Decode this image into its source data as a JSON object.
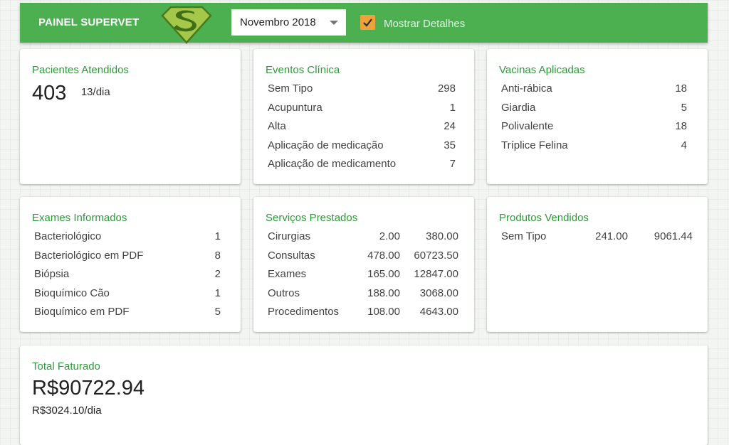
{
  "header": {
    "brand": "PAINEL SUPERVET",
    "month_selected": "Novembro 2018",
    "show_details_label": "Mostrar Detalhes",
    "show_details_checked": true
  },
  "colors": {
    "header_bg": "#4caf50",
    "accent": "#f0a23a",
    "title": "#2e9a3a"
  },
  "pacientes": {
    "title": "Pacientes Atendidos",
    "total": "403",
    "per_day": "13/dia"
  },
  "eventos": {
    "title": "Eventos Clínica",
    "rows": [
      {
        "label": "Sem Tipo",
        "value": "298"
      },
      {
        "label": "Acupuntura",
        "value": "1"
      },
      {
        "label": "Alta",
        "value": "24"
      },
      {
        "label": "Aplicação de medicação",
        "value": "35"
      },
      {
        "label": "Aplicação de medicamento",
        "value": "7"
      }
    ]
  },
  "vacinas": {
    "title": "Vacinas Aplicadas",
    "rows": [
      {
        "label": "Anti-rábica",
        "value": "18"
      },
      {
        "label": "Giardia",
        "value": "5"
      },
      {
        "label": "Polivalente",
        "value": "18"
      },
      {
        "label": "Tríplice Felina",
        "value": "4"
      }
    ]
  },
  "exames": {
    "title": "Exames Informados",
    "rows": [
      {
        "label": "Bacteriológico",
        "value": "1"
      },
      {
        "label": "Bacteriológico em PDF",
        "value": "8"
      },
      {
        "label": "Biópsia",
        "value": "2"
      },
      {
        "label": "Bioquímico Cão",
        "value": "1"
      },
      {
        "label": "Bioquímico em PDF",
        "value": "5"
      }
    ]
  },
  "servicos": {
    "title": "Serviços Prestados",
    "rows": [
      {
        "label": "Cirurgias",
        "qty": "2.00",
        "amount": "380.00"
      },
      {
        "label": "Consultas",
        "qty": "478.00",
        "amount": "60723.50"
      },
      {
        "label": "Exames",
        "qty": "165.00",
        "amount": "12847.00"
      },
      {
        "label": "Outros",
        "qty": "188.00",
        "amount": "3068.00"
      },
      {
        "label": "Procedimentos",
        "qty": "108.00",
        "amount": "4643.00"
      }
    ]
  },
  "produtos": {
    "title": "Produtos Vendidos",
    "rows": [
      {
        "label": "Sem Tipo",
        "qty": "241.00",
        "amount": "9061.44"
      }
    ]
  },
  "total": {
    "title": "Total Faturado",
    "value": "R$90722.94",
    "per_day": "R$3024.10/dia"
  }
}
